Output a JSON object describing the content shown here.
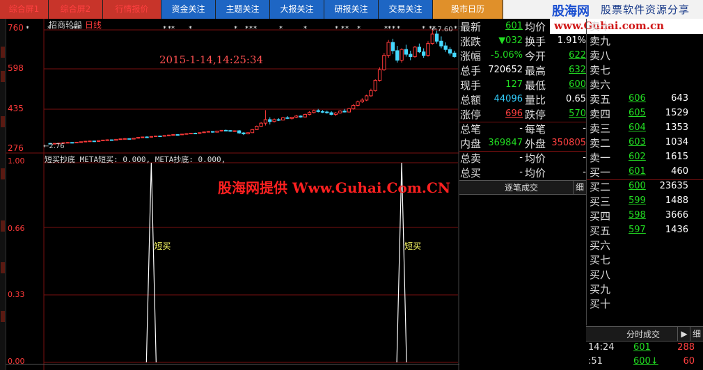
{
  "tabs": [
    {
      "label": "综合屏1",
      "style": "red",
      "w": 70
    },
    {
      "label": "综合屏2",
      "style": "red",
      "w": 78
    },
    {
      "label": "行情报价",
      "style": "red",
      "w": 84
    },
    {
      "label": "资金关注",
      "style": "blue",
      "w": 78
    },
    {
      "label": "主题关注",
      "style": "blue",
      "w": 78
    },
    {
      "label": "大报关注",
      "style": "blue",
      "w": 78
    },
    {
      "label": "研报关注",
      "style": "blue",
      "w": 78
    },
    {
      "label": "交易关注",
      "style": "blue",
      "w": 78
    },
    {
      "label": "股市日历",
      "style": "orange",
      "w": 101
    }
  ],
  "brand": {
    "name": "股海网",
    "slogan": "股票软件资源分享",
    "url": "www.Guhai.com.cn"
  },
  "chart": {
    "stock_name": "招商轮船",
    "period": "日线",
    "date_stamp": "2015-1-14,14:25:34",
    "price_labels": [
      "760",
      "598",
      "435",
      "276"
    ],
    "min_label": "←2.76",
    "max_label": "←7.60",
    "indicator_line": "短买抄底 META短买: 0.000, META抄底: 0.000,",
    "indicator_labels": [
      "1.00",
      "0.66",
      "0.33",
      "0.00"
    ],
    "watermark": "股海网提供 Www.Guhai.Com.CN",
    "signal_label": "短买",
    "colors": {
      "up": "#ff3a3a",
      "down": "#44d8ff",
      "grid": "#7a1010"
    }
  },
  "chart_data": {
    "type": "candlestick",
    "ylim": [
      2.6,
      7.75
    ],
    "candles": [
      [
        2.8,
        2.82,
        2.76,
        2.79
      ],
      [
        2.79,
        2.81,
        2.77,
        2.8
      ],
      [
        2.8,
        2.83,
        2.78,
        2.81
      ],
      [
        2.81,
        2.84,
        2.79,
        2.83
      ],
      [
        2.83,
        2.86,
        2.81,
        2.84
      ],
      [
        2.84,
        2.85,
        2.8,
        2.82
      ],
      [
        2.82,
        2.86,
        2.81,
        2.85
      ],
      [
        2.85,
        2.88,
        2.83,
        2.87
      ],
      [
        2.87,
        2.9,
        2.85,
        2.89
      ],
      [
        2.89,
        2.92,
        2.87,
        2.9
      ],
      [
        2.9,
        2.91,
        2.86,
        2.88
      ],
      [
        2.88,
        2.93,
        2.87,
        2.92
      ],
      [
        2.92,
        2.95,
        2.9,
        2.94
      ],
      [
        2.94,
        2.97,
        2.92,
        2.95
      ],
      [
        2.95,
        2.96,
        2.91,
        2.93
      ],
      [
        2.93,
        2.98,
        2.92,
        2.97
      ],
      [
        2.97,
        3.0,
        2.95,
        2.99
      ],
      [
        2.99,
        3.02,
        2.97,
        3.0
      ],
      [
        3.0,
        3.01,
        2.96,
        2.98
      ],
      [
        2.98,
        3.03,
        2.97,
        3.02
      ],
      [
        3.02,
        3.06,
        3.0,
        3.05
      ],
      [
        3.05,
        3.08,
        3.03,
        3.07
      ],
      [
        3.07,
        3.1,
        3.04,
        3.06
      ],
      [
        3.06,
        3.1,
        3.05,
        3.09
      ],
      [
        3.09,
        3.12,
        3.07,
        3.11
      ],
      [
        3.11,
        3.13,
        3.08,
        3.1
      ],
      [
        3.1,
        3.14,
        3.09,
        3.13
      ],
      [
        3.13,
        3.16,
        3.11,
        3.15
      ],
      [
        3.15,
        3.18,
        3.13,
        3.17
      ],
      [
        3.17,
        3.19,
        3.14,
        3.16
      ],
      [
        3.16,
        3.2,
        3.15,
        3.19
      ],
      [
        3.19,
        3.22,
        3.17,
        3.21
      ],
      [
        3.21,
        3.24,
        3.19,
        3.23
      ],
      [
        3.23,
        3.25,
        3.2,
        3.22
      ],
      [
        3.22,
        3.26,
        3.21,
        3.25
      ],
      [
        3.25,
        3.3,
        3.24,
        3.28
      ],
      [
        3.28,
        3.32,
        3.26,
        3.3
      ],
      [
        3.3,
        3.31,
        3.25,
        3.27
      ],
      [
        3.27,
        3.33,
        3.26,
        3.32
      ],
      [
        3.32,
        3.36,
        3.3,
        3.35
      ],
      [
        3.35,
        3.38,
        3.32,
        3.34
      ],
      [
        3.34,
        3.36,
        3.29,
        3.31
      ],
      [
        3.31,
        3.35,
        3.28,
        3.33
      ],
      [
        3.33,
        3.36,
        3.2,
        3.24
      ],
      [
        3.24,
        3.27,
        3.15,
        3.2
      ],
      [
        3.2,
        3.26,
        3.18,
        3.25
      ],
      [
        3.25,
        3.4,
        3.24,
        3.38
      ],
      [
        3.38,
        3.55,
        3.36,
        3.52
      ],
      [
        3.52,
        3.7,
        3.5,
        3.65
      ],
      [
        3.65,
        4.2,
        3.55,
        3.8
      ],
      [
        3.8,
        3.9,
        3.6,
        3.72
      ],
      [
        3.72,
        3.85,
        3.68,
        3.8
      ],
      [
        3.8,
        3.86,
        3.74,
        3.78
      ],
      [
        3.78,
        3.92,
        3.76,
        3.88
      ],
      [
        3.88,
        3.95,
        3.82,
        3.85
      ],
      [
        3.85,
        3.92,
        3.8,
        3.9
      ],
      [
        3.9,
        4.0,
        3.86,
        3.95
      ],
      [
        3.95,
        3.98,
        3.88,
        3.91
      ],
      [
        3.91,
        4.05,
        3.9,
        4.02
      ],
      [
        4.02,
        4.15,
        3.98,
        4.1
      ],
      [
        4.1,
        4.22,
        4.06,
        4.18
      ],
      [
        4.18,
        4.25,
        4.1,
        4.14
      ],
      [
        4.14,
        4.2,
        4.08,
        4.12
      ],
      [
        4.12,
        4.18,
        4.05,
        4.09
      ],
      [
        4.09,
        4.15,
        3.98,
        4.02
      ],
      [
        4.02,
        4.12,
        3.95,
        4.08
      ],
      [
        4.08,
        4.2,
        4.05,
        4.16
      ],
      [
        4.16,
        4.25,
        4.1,
        4.12
      ],
      [
        4.12,
        4.3,
        4.1,
        4.26
      ],
      [
        4.26,
        4.45,
        4.22,
        4.4
      ],
      [
        4.4,
        4.6,
        4.36,
        4.55
      ],
      [
        4.55,
        4.7,
        4.5,
        4.62
      ],
      [
        4.62,
        4.85,
        4.58,
        4.8
      ],
      [
        4.8,
        5.1,
        4.76,
        5.02
      ],
      [
        5.02,
        5.5,
        4.98,
        5.45
      ],
      [
        5.45,
        6.0,
        5.4,
        5.9
      ],
      [
        5.9,
        6.6,
        5.85,
        6.5
      ],
      [
        6.5,
        7.15,
        6.4,
        7.05
      ],
      [
        7.05,
        7.2,
        6.55,
        6.7
      ],
      [
        6.7,
        6.9,
        6.2,
        6.3
      ],
      [
        6.3,
        6.8,
        6.2,
        6.75
      ],
      [
        6.75,
        6.95,
        6.45,
        6.55
      ],
      [
        6.55,
        6.7,
        6.3,
        6.45
      ],
      [
        6.45,
        6.9,
        6.4,
        6.85
      ],
      [
        6.85,
        7.0,
        6.6,
        6.65
      ],
      [
        6.65,
        6.8,
        6.4,
        6.5
      ],
      [
        6.5,
        7.1,
        6.45,
        7.0
      ],
      [
        7.0,
        7.6,
        6.95,
        7.4
      ],
      [
        7.4,
        7.55,
        7.0,
        7.1
      ],
      [
        7.1,
        7.3,
        6.8,
        6.9
      ],
      [
        6.9,
        7.05,
        6.65,
        6.75
      ],
      [
        6.75,
        6.85,
        6.5,
        6.6
      ],
      [
        6.6,
        6.7,
        6.4,
        6.45
      ]
    ],
    "signals": [
      23,
      80
    ],
    "signal_range": [
      0,
      1
    ]
  },
  "quote": {
    "rows": [
      {
        "l1": "最新",
        "v1": "601",
        "c1": "green",
        "u1": true,
        "l2": "均价",
        "v2": "",
        "c2": "white"
      },
      {
        "l1": "涨跌",
        "v1": "▼032",
        "c1": "green",
        "l2": "换手",
        "v2": "1.91%",
        "c2": "white"
      },
      {
        "l1": "涨幅",
        "v1": "-5.06%",
        "c1": "green",
        "l2": "今开",
        "v2": "622",
        "c2": "green",
        "u2": true
      },
      {
        "l1": "总手",
        "v1": "720652",
        "c1": "white",
        "l2": "最高",
        "v2": "632",
        "c2": "green",
        "u2": true
      },
      {
        "l1": "现手",
        "v1": "127",
        "c1": "green",
        "l2": "最低",
        "v2": "600",
        "c2": "green",
        "u2": true
      },
      {
        "l1": "总额",
        "v1": "44096",
        "c1": "cyan",
        "l2": "量比",
        "v2": "0.65",
        "c2": "white"
      },
      {
        "l1": "涨停",
        "v1": "696",
        "c1": "red",
        "u1": true,
        "l2": "跌停",
        "v2": "570",
        "c2": "green",
        "u2": true
      },
      {
        "l1": "总笔",
        "v1": "-",
        "c1": "white",
        "l2": "每笔",
        "v2": "-",
        "c2": "white"
      },
      {
        "l1": "内盘",
        "v1": "369847",
        "c1": "green",
        "l2": "外盘",
        "v2": "350805",
        "c2": "red"
      },
      {
        "l1": "总卖",
        "v1": "-",
        "c1": "white",
        "l2": "均价",
        "v2": "-",
        "c2": "white"
      },
      {
        "l1": "总买",
        "v1": "-",
        "c1": "white",
        "l2": "均价",
        "v2": "-",
        "c2": "white"
      }
    ],
    "tick_header": "逐笔成交",
    "detail_label": "细"
  },
  "book": {
    "rows": [
      {
        "label": "卖十",
        "price": "",
        "vol": ""
      },
      {
        "label": "卖九",
        "price": "",
        "vol": ""
      },
      {
        "label": "卖八",
        "price": "",
        "vol": ""
      },
      {
        "label": "卖七",
        "price": "",
        "vol": ""
      },
      {
        "label": "卖六",
        "price": "",
        "vol": ""
      },
      {
        "label": "卖五",
        "price": "606",
        "vol": "643"
      },
      {
        "label": "卖四",
        "price": "605",
        "vol": "1529"
      },
      {
        "label": "卖三",
        "price": "604",
        "vol": "1353"
      },
      {
        "label": "卖二",
        "price": "603",
        "vol": "1034"
      },
      {
        "label": "卖一",
        "price": "602",
        "vol": "1615"
      },
      {
        "label": "买一",
        "price": "601",
        "vol": "460"
      },
      {
        "label": "买二",
        "price": "600",
        "vol": "23635"
      },
      {
        "label": "买三",
        "price": "599",
        "vol": "1488"
      },
      {
        "label": "买四",
        "price": "598",
        "vol": "3666"
      },
      {
        "label": "买五",
        "price": "597",
        "vol": "1436"
      },
      {
        "label": "买六",
        "price": "",
        "vol": ""
      },
      {
        "label": "买七",
        "price": "",
        "vol": ""
      },
      {
        "label": "买八",
        "price": "",
        "vol": ""
      },
      {
        "label": "买九",
        "price": "",
        "vol": ""
      },
      {
        "label": "买十",
        "price": "",
        "vol": ""
      }
    ],
    "minute_header": "分时成交",
    "btn_play": "▶",
    "btn_detail": "细",
    "ticks": [
      {
        "time": "14:24",
        "price": "601",
        "vol": "288"
      },
      {
        "time": ":51",
        "price": "600↓",
        "vol": "60"
      }
    ]
  }
}
